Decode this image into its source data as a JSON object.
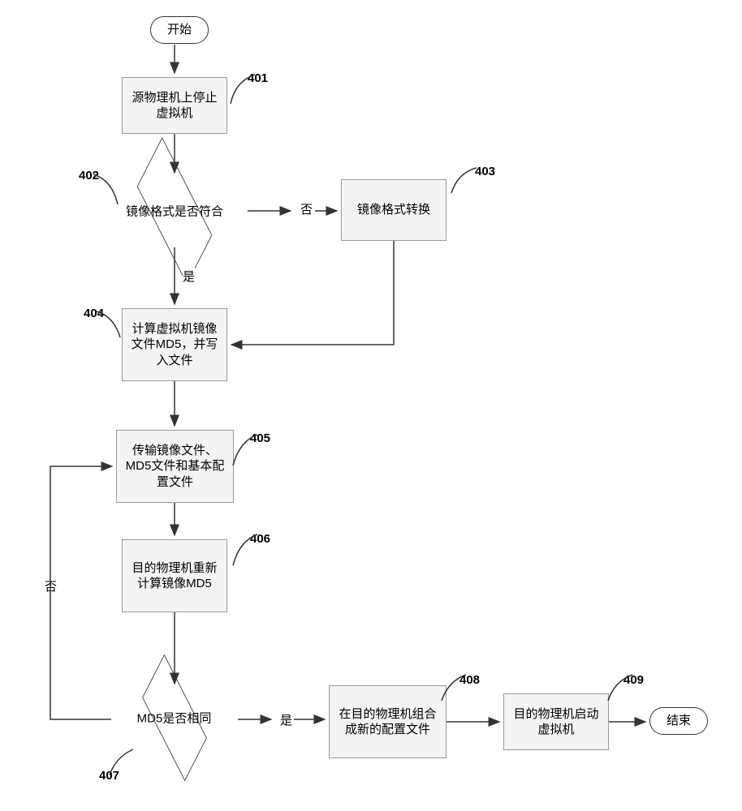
{
  "nodes": {
    "start": "开始",
    "end": "结束",
    "401": "源物理机上停止虚拟机",
    "402": "镜像格式是否符合",
    "403": "镜像格式转换",
    "404": "计算虚拟机镜像文件MD5，并写入文件",
    "405": "传输镜像文件、MD5文件和基本配置文件",
    "406": "目的物理机重新计算镜像MD5",
    "407": "MD5是否相同",
    "408": "在目的物理机组合成新的配置文件",
    "409": "目的物理机启动虚拟机"
  },
  "labels": {
    "401": "401",
    "402": "402",
    "403": "403",
    "404": "404",
    "405": "405",
    "406": "406",
    "407": "407",
    "408": "408",
    "409": "409"
  },
  "edges": {
    "yes": "是",
    "no": "否"
  }
}
